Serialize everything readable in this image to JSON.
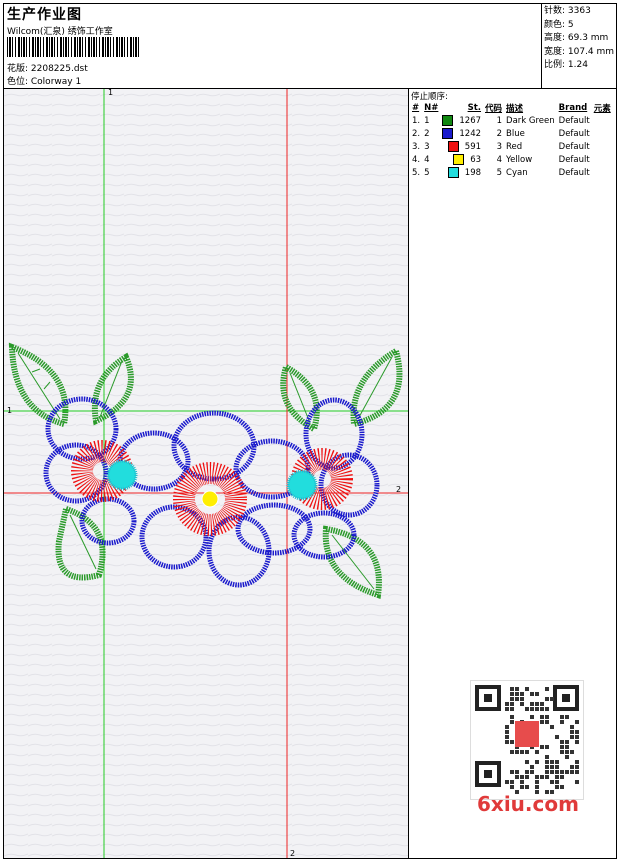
{
  "header": {
    "title": "生产作业图",
    "company": "Wilcom(汇泉) 绣饰工作室",
    "design_label": "花版: 2208225.dst",
    "colorway_label": "色位: Colorway 1"
  },
  "stats": {
    "stitches": "针数: 3363",
    "colors": "颜色: 5",
    "height": "高度: 69.3 mm",
    "width": "宽度: 107.4 mm",
    "ratio": "比例: 1.24"
  },
  "guides": {
    "g1_top": "1",
    "g1_left": "1",
    "g2_right": "2",
    "g2_bottom": "2"
  },
  "stop_sequence": {
    "title": "停止顺序:",
    "headers": [
      "#",
      "N#",
      "St.",
      "代码",
      "描述",
      "Brand",
      "元素"
    ],
    "rows": [
      {
        "idx": "1.",
        "n": "1",
        "st": "1267",
        "code": "1",
        "desc": "Dark Green",
        "brand": "Default",
        "color": "#118811"
      },
      {
        "idx": "2.",
        "n": "2",
        "st": "1242",
        "code": "2",
        "desc": "Blue",
        "brand": "Default",
        "color": "#1a1acc"
      },
      {
        "idx": "3.",
        "n": "3",
        "st": "591",
        "code": "3",
        "desc": "Red",
        "brand": "Default",
        "color": "#ee1111"
      },
      {
        "idx": "4.",
        "n": "4",
        "st": "63",
        "code": "4",
        "desc": "Yellow",
        "brand": "Default",
        "color": "#ffee00"
      },
      {
        "idx": "5.",
        "n": "5",
        "st": "198",
        "code": "5",
        "desc": "Cyan",
        "brand": "Default",
        "color": "#22dddd"
      }
    ]
  },
  "watermark": {
    "text": "6xiu.com"
  }
}
